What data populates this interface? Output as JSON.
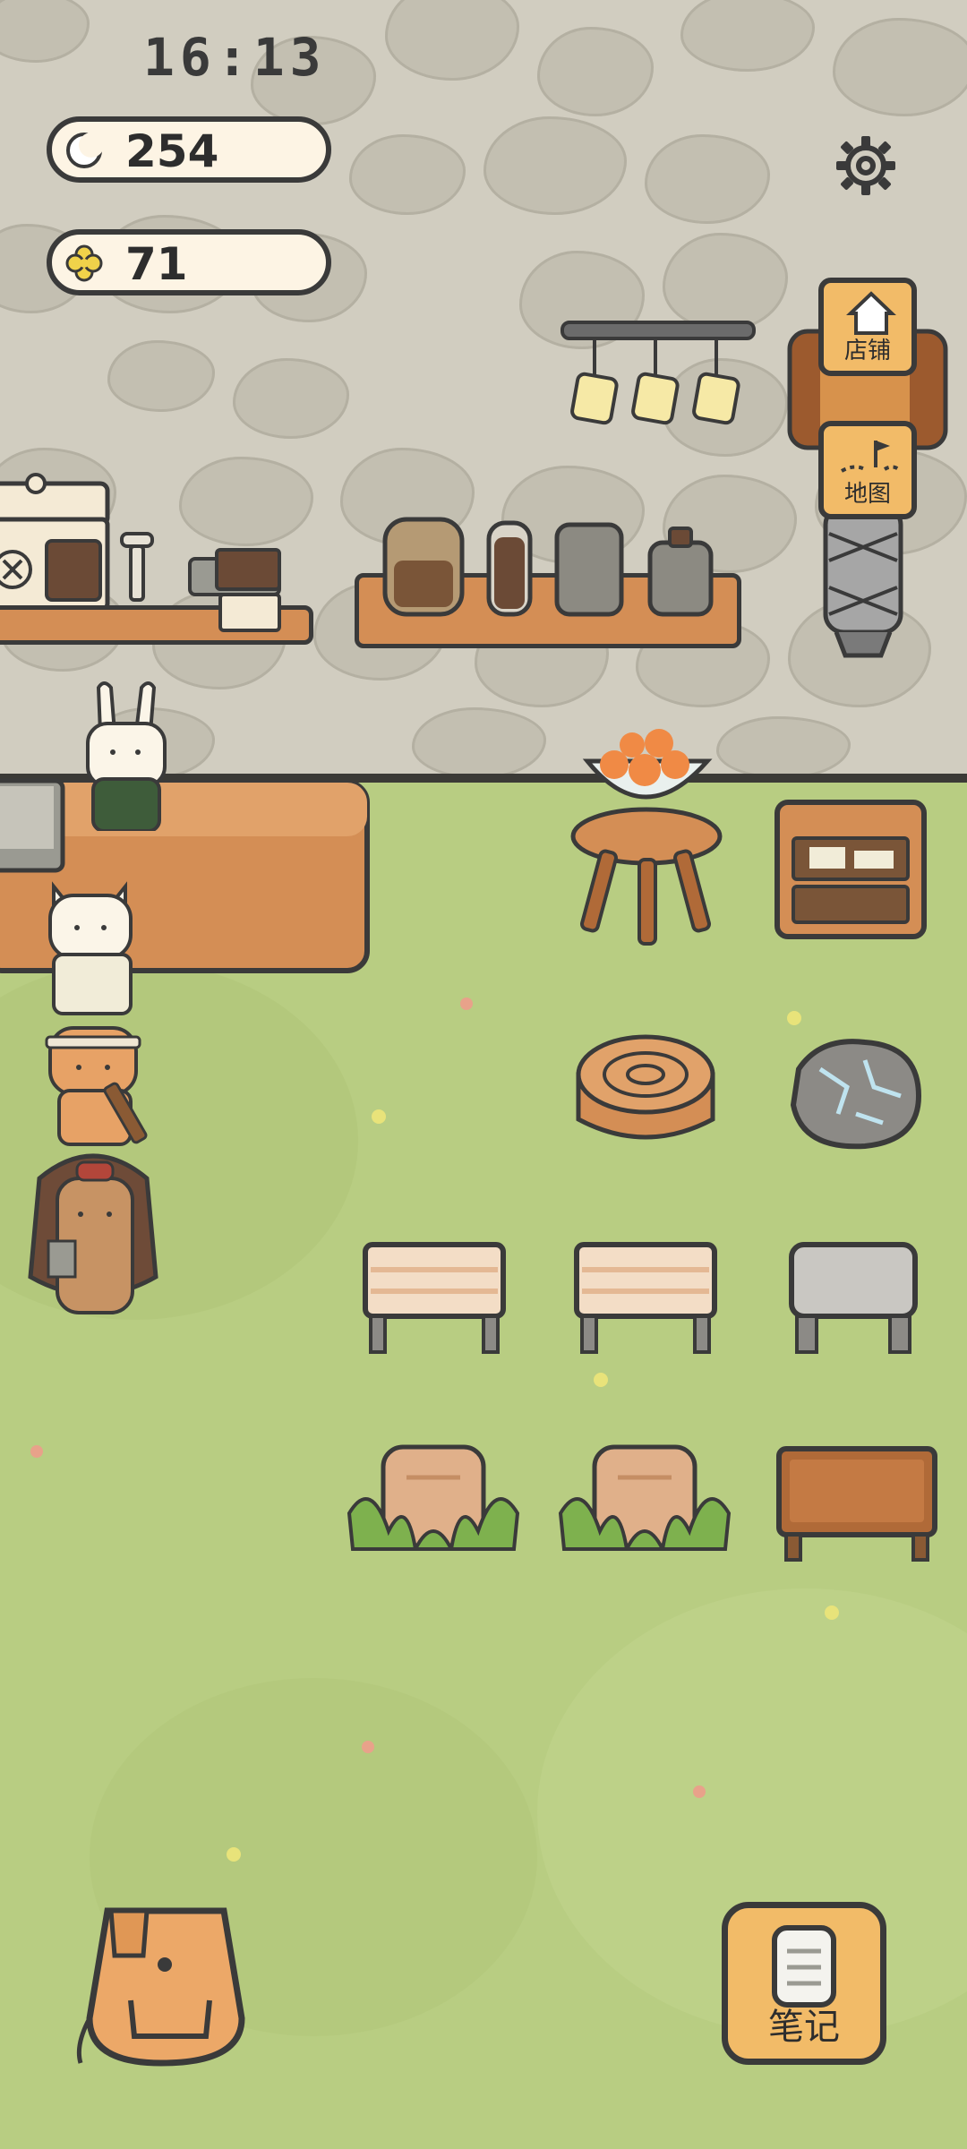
{
  "status_bar": {
    "time": "16:13"
  },
  "currency": {
    "moon": {
      "icon": "moon-icon",
      "value": "254"
    },
    "clover": {
      "icon": "clover-icon",
      "value": "71"
    }
  },
  "side_menu": {
    "shop": {
      "icon": "house-icon",
      "label": "店铺"
    },
    "map": {
      "icon": "map-flag-icon",
      "label": "地图"
    }
  },
  "bottom_bar": {
    "notes": {
      "icon": "notebook-icon",
      "label": "笔记"
    },
    "backpack": {
      "icon": "backpack-icon"
    }
  },
  "colors": {
    "wall": "#d1cdc0",
    "grass": "#b8cd82",
    "button": "#f2bb68",
    "outline": "#3a3a3a",
    "pill": "#fdf4e4"
  }
}
